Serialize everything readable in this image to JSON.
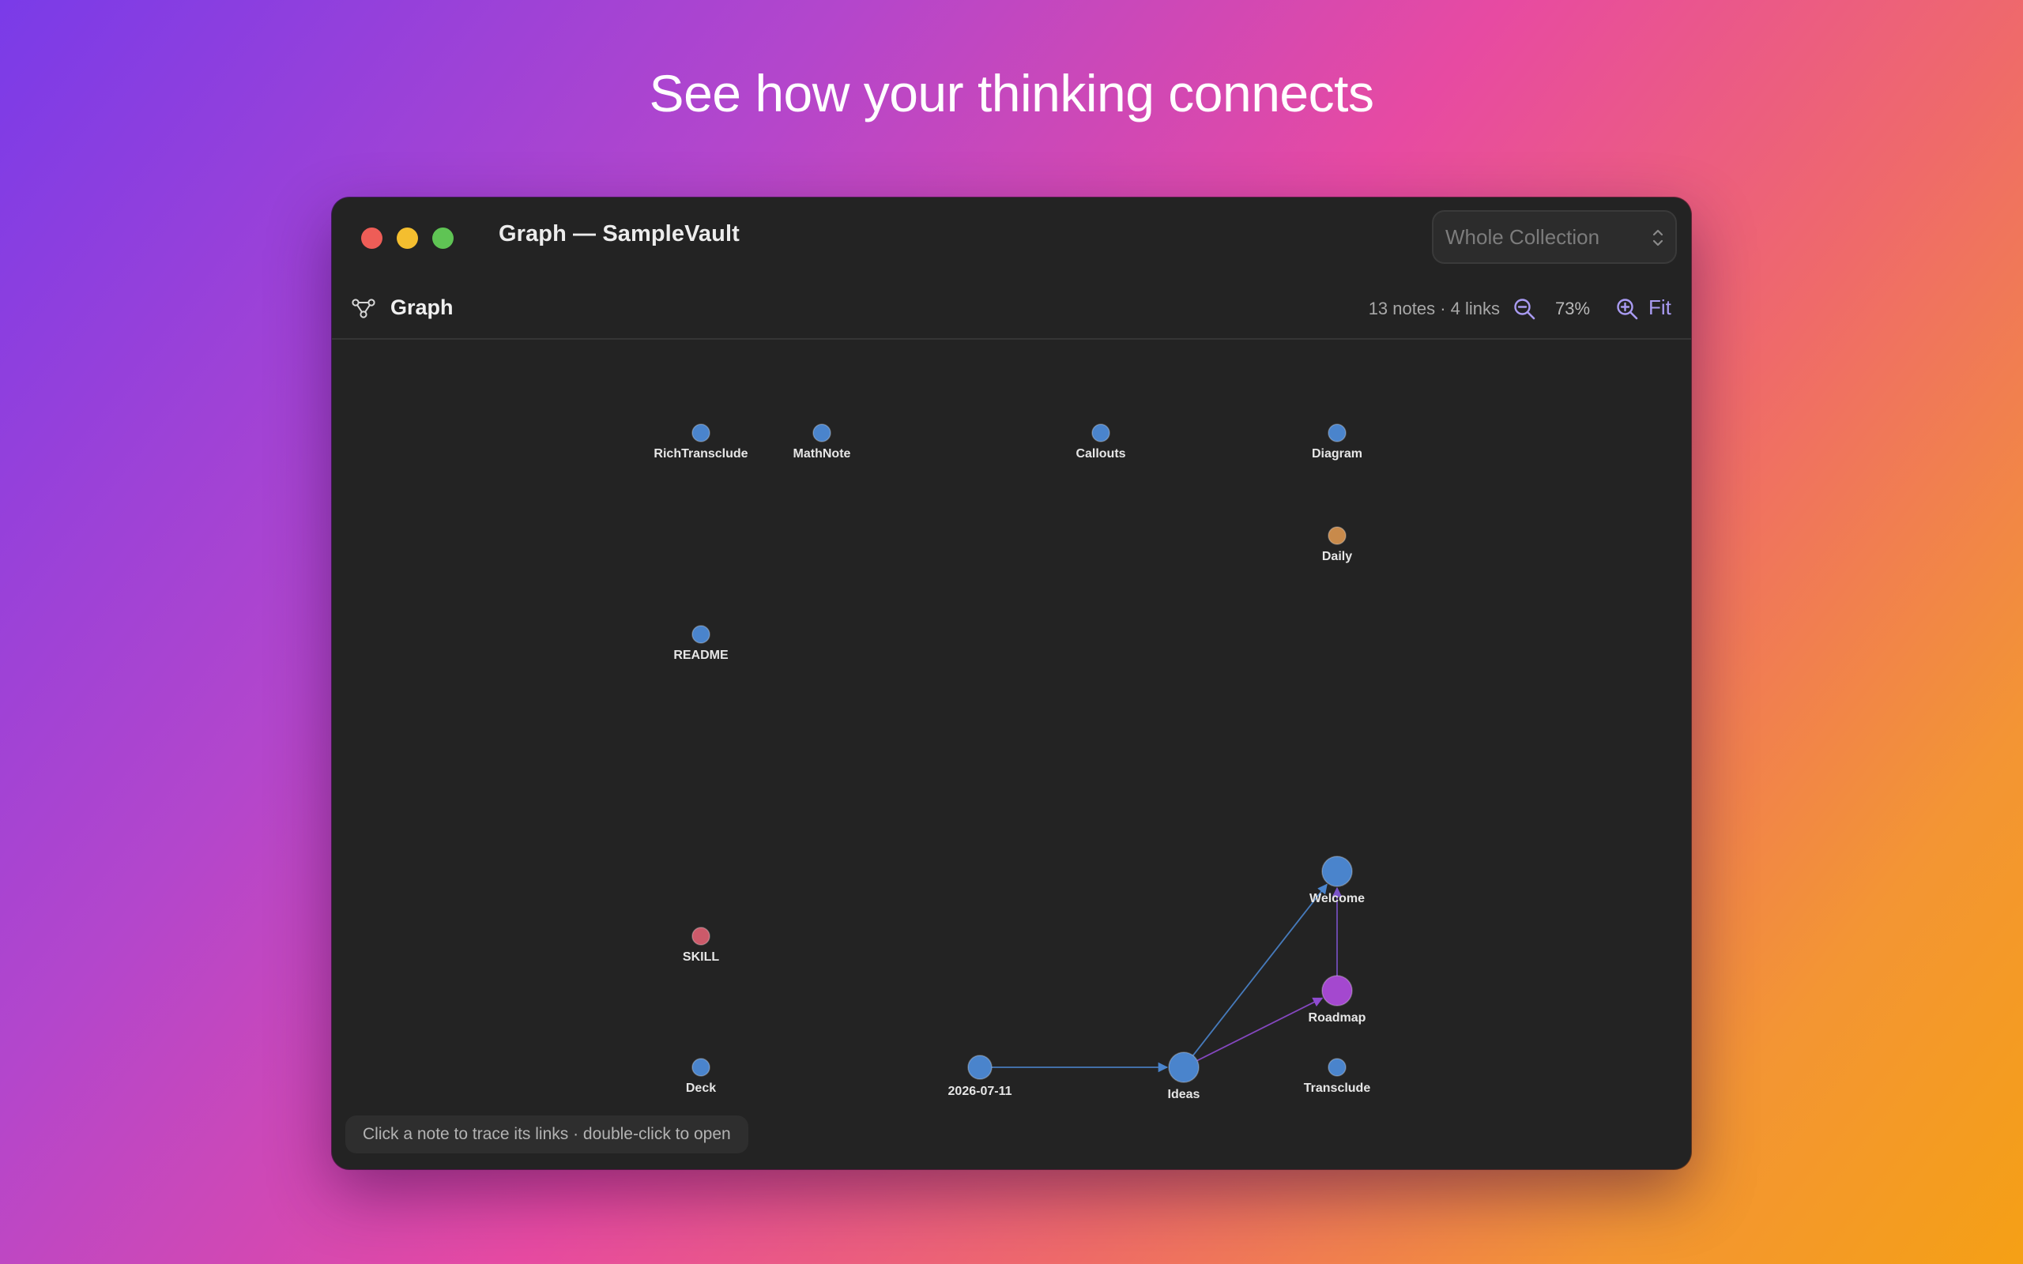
{
  "headline": "See how your thinking connects",
  "window": {
    "title": "Graph — SampleVault",
    "scope": {
      "selected": "Whole Collection"
    }
  },
  "toolbar": {
    "title": "Graph",
    "stats": "13 notes · 4 links",
    "zoom_level": "73%",
    "fit_label": "Fit"
  },
  "graph": {
    "nodes": [
      {
        "id": "RichTransclude",
        "label": "RichTransclude",
        "color": "#4a84cc",
        "size": "small"
      },
      {
        "id": "MathNote",
        "label": "MathNote",
        "color": "#4a84cc",
        "size": "small"
      },
      {
        "id": "Callouts",
        "label": "Callouts",
        "color": "#4a84cc",
        "size": "small"
      },
      {
        "id": "Diagram",
        "label": "Diagram",
        "color": "#4a84cc",
        "size": "small"
      },
      {
        "id": "Daily",
        "label": "Daily",
        "color": "#c88a4b",
        "size": "small"
      },
      {
        "id": "README",
        "label": "README",
        "color": "#4a84cc",
        "size": "small"
      },
      {
        "id": "Welcome",
        "label": "Welcome",
        "color": "#4a84cc",
        "size": "large"
      },
      {
        "id": "SKILL",
        "label": "SKILL",
        "color": "#cc5a6a",
        "size": "small"
      },
      {
        "id": "Roadmap",
        "label": "Roadmap",
        "color": "#a448cf",
        "size": "large"
      },
      {
        "id": "Deck",
        "label": "Deck",
        "color": "#4a84cc",
        "size": "small"
      },
      {
        "id": "2026-07-11",
        "label": "2026-07-11",
        "color": "#4a84cc",
        "size": "medium"
      },
      {
        "id": "Ideas",
        "label": "Ideas",
        "color": "#4a84cc",
        "size": "large"
      },
      {
        "id": "Transclude",
        "label": "Transclude",
        "color": "#4a84cc",
        "size": "small"
      }
    ],
    "links": [
      {
        "source": "2026-07-11",
        "target": "Ideas",
        "color": "#4a84cc"
      },
      {
        "source": "Ideas",
        "target": "Welcome",
        "color": "#4a84cc"
      },
      {
        "source": "Ideas",
        "target": "Roadmap",
        "color": "#8f4bd0"
      },
      {
        "source": "Roadmap",
        "target": "Welcome",
        "color": "#7a52c8"
      }
    ]
  },
  "hint": "Click a note to trace its links · double-click to open"
}
